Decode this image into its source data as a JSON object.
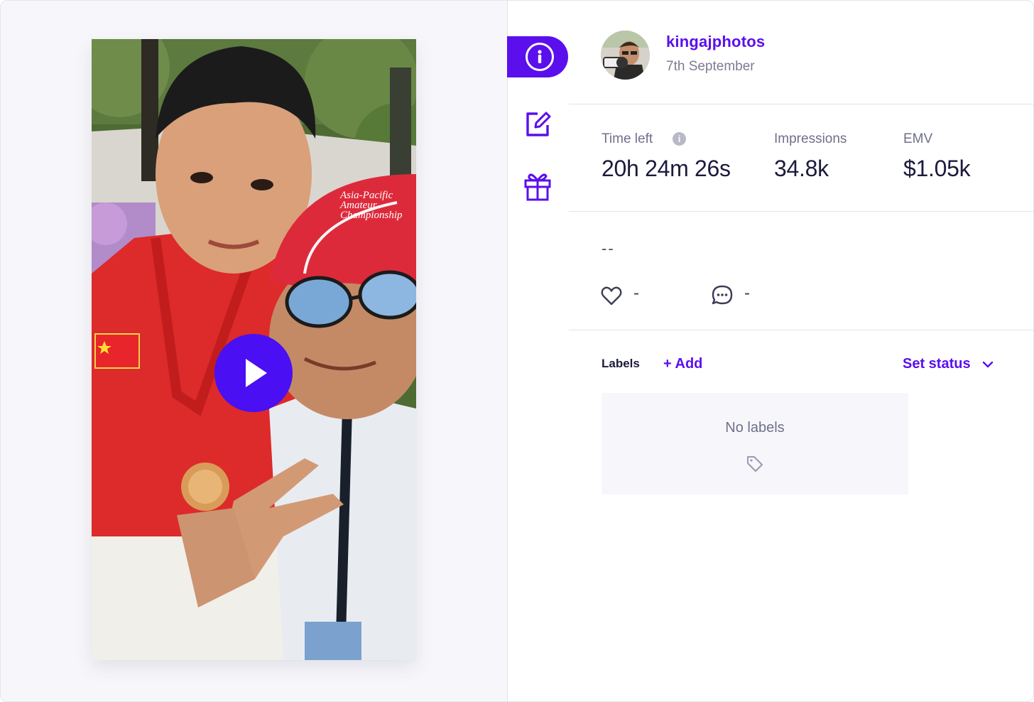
{
  "post": {
    "username": "kingajphotos",
    "date": "7th September",
    "caption": "--"
  },
  "stats": {
    "time_left_label": "Time left",
    "time_left_value": "20h 24m 26s",
    "impressions_label": "Impressions",
    "impressions_value": "34.8k",
    "emv_label": "EMV",
    "emv_value": "$1.05k"
  },
  "engagement": {
    "likes": "-",
    "comments": "-"
  },
  "labels": {
    "title": "Labels",
    "add_label": "+ Add",
    "status_label": "Set status",
    "empty_text": "No labels"
  },
  "rail": {
    "items": [
      "info-icon",
      "edit-icon",
      "gift-icon"
    ],
    "active": "info-icon"
  },
  "media": {
    "type": "video",
    "hat_text_line1": "Asia-Pacific",
    "hat_text_line2": "Amateur",
    "hat_text_line3": "Championship",
    "lanyard_text": "Asia-Pacific Amateur Championship"
  },
  "colors": {
    "accent": "#5b0fec",
    "play_button": "#4a0ff2",
    "text_primary": "#1c1a3d",
    "text_muted": "#6f6f8c"
  }
}
